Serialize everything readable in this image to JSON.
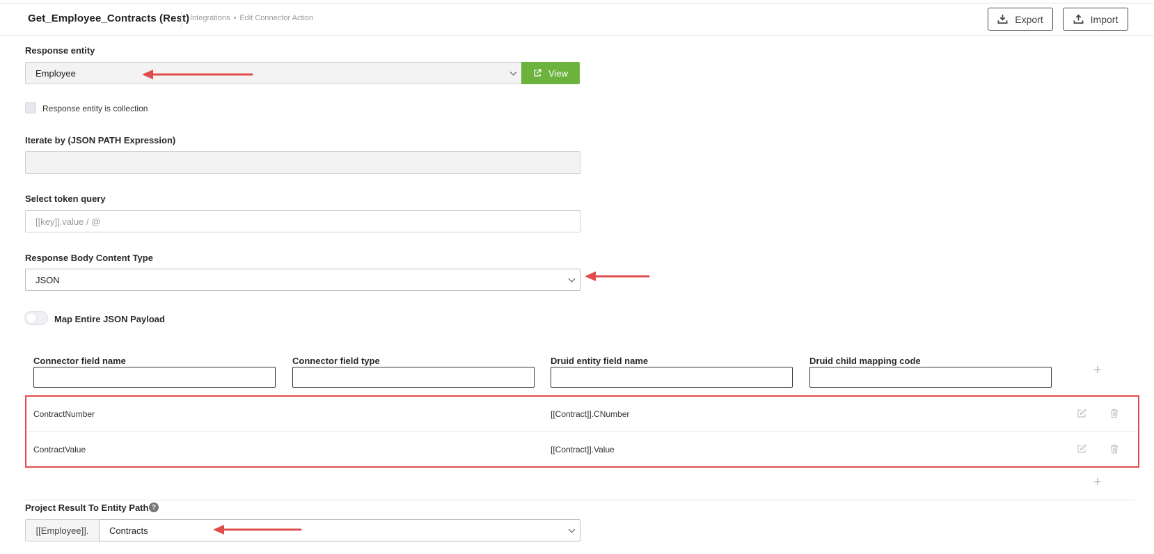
{
  "header": {
    "title": "Get_Employee_Contracts (Rest)",
    "breadcrumb": [
      "Integrations",
      "Edit Connector Action"
    ],
    "breadcrumb_separator": "•",
    "export_label": "Export",
    "import_label": "Import"
  },
  "form": {
    "response_entity_label": "Response entity",
    "response_entity_value": "Employee",
    "view_label": "View",
    "collection_checkbox_label": "Response entity is collection",
    "collection_checked": false,
    "iterate_label": "Iterate by (JSON PATH Expression)",
    "iterate_value": "",
    "token_query_label": "Select token query",
    "token_query_placeholder": "[[key]].value / @",
    "content_type_label": "Response Body Content Type",
    "content_type_value": "JSON",
    "map_payload_label": "Map Entire JSON Payload",
    "map_payload_on": false
  },
  "mapping": {
    "columns": [
      "Connector field name",
      "Connector field type",
      "Druid entity field name",
      "Druid child mapping code"
    ],
    "rows": [
      {
        "connector_field_name": "ContractNumber",
        "connector_field_type": "",
        "druid_entity_field_name": "[[Contract]].CNumber",
        "druid_child_mapping_code": ""
      },
      {
        "connector_field_name": "ContractValue",
        "connector_field_type": "",
        "druid_entity_field_name": "[[Contract]].Value",
        "druid_child_mapping_code": ""
      }
    ],
    "add_icon": "plus-icon"
  },
  "project": {
    "label": "Project Result To Entity Path",
    "help_glyph": "?",
    "prefix": "[[Employee]].",
    "value": "Contracts"
  },
  "colors": {
    "accent_green": "#6cb33e",
    "annotation_red": "#e14b4b"
  }
}
